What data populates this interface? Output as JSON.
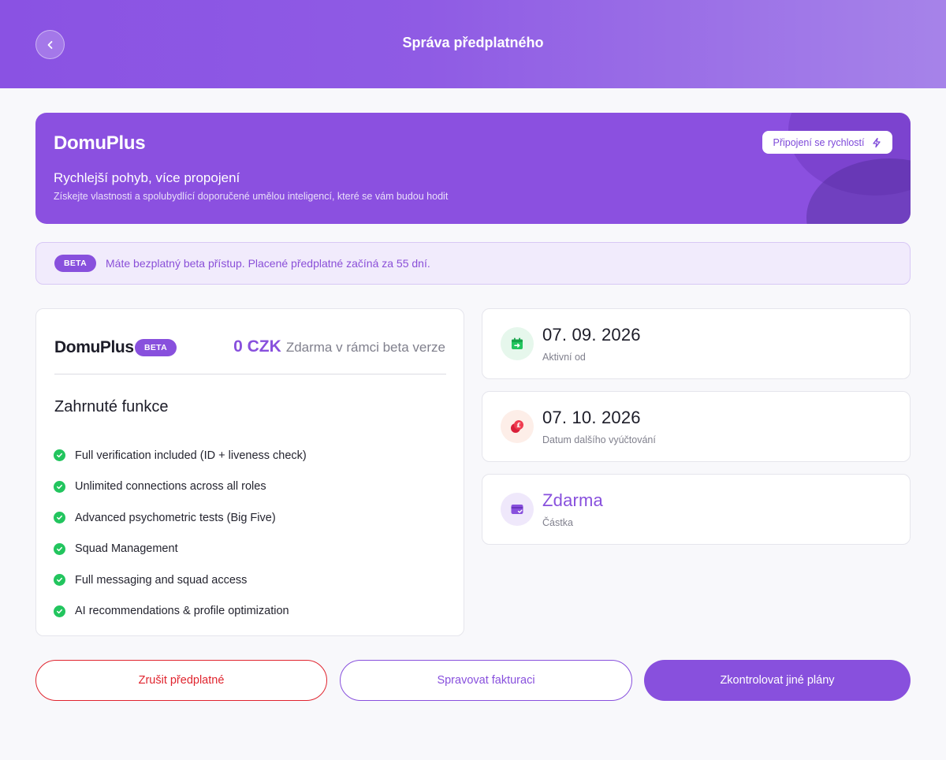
{
  "header": {
    "title": "Správa předplatného"
  },
  "hero": {
    "title": "DomuPlus",
    "subtitle": "Rychlejší pohyb, více propojení",
    "description": "Získejte vlastnosti a spolubydlící doporučené umělou inteligencí, které se vám budou hodit",
    "speed_button_label": "Připojení se rychlostí"
  },
  "beta_notice": {
    "badge": "BETA",
    "text": "Máte bezplatný beta přístup. Placené předplatné začíná za 55 dní."
  },
  "plan": {
    "name": "DomuPlus",
    "badge": "BETA",
    "price_amount": "0 CZK",
    "price_note": "Zdarma v rámci beta verze",
    "features_title": "Zahrnuté funkce",
    "features": [
      "Full verification included (ID + liveness check)",
      "Unlimited connections across all roles",
      "Advanced psychometric tests (Big Five)",
      "Squad Management",
      "Full messaging and squad access",
      "AI recommendations & profile optimization"
    ]
  },
  "info_cards": [
    {
      "value": "07. 09. 2026",
      "label": "Aktivní od",
      "icon": "calendar-icon"
    },
    {
      "value": "07. 10. 2026",
      "label": "Datum dalšího vyúčtování",
      "icon": "coins-icon"
    },
    {
      "value": "Zdarma",
      "label": "Částka",
      "icon": "card-icon"
    }
  ],
  "actions": {
    "cancel_label": "Zrušit předplatné",
    "billing_label": "Spravovat fakturaci",
    "plans_label": "Zkontrolovat jiné plány"
  },
  "colors": {
    "accent": "#8850dd",
    "danger": "#e0242e",
    "success": "#22c55e"
  }
}
